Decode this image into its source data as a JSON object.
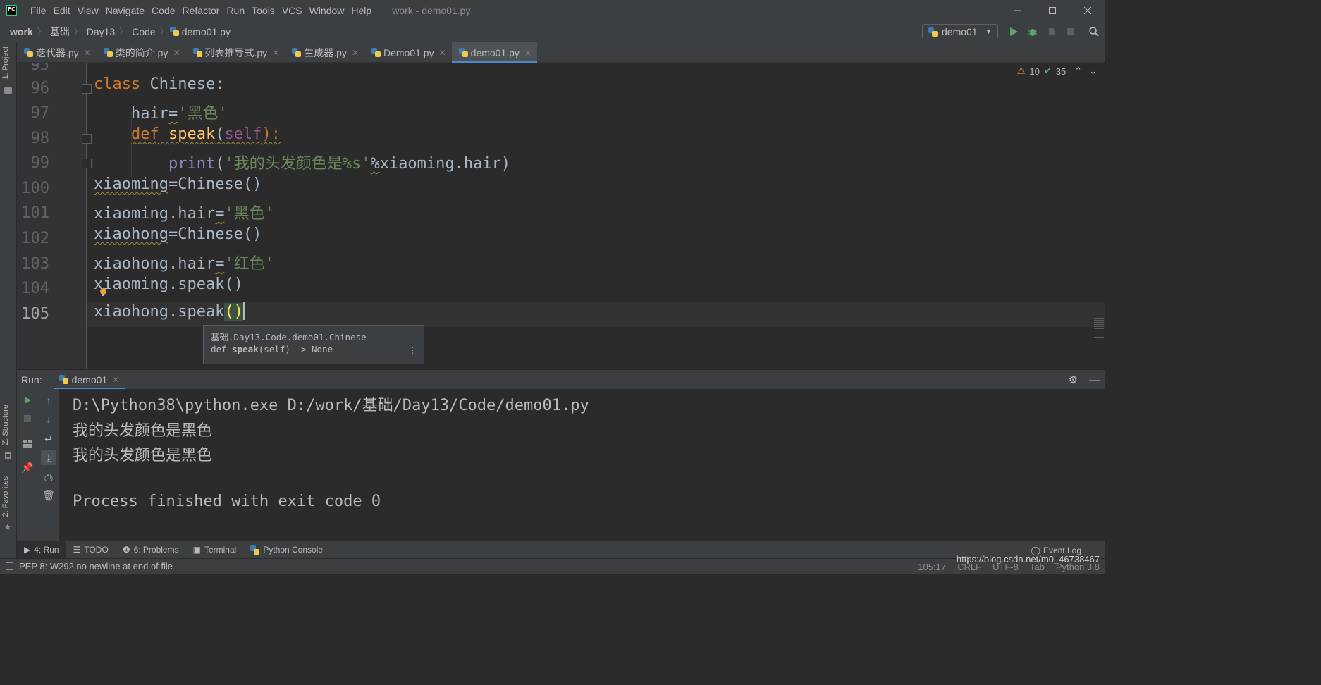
{
  "window": {
    "title": "work - demo01.py",
    "menu": [
      "File",
      "Edit",
      "View",
      "Navigate",
      "Code",
      "Refactor",
      "Run",
      "Tools",
      "VCS",
      "Window",
      "Help"
    ],
    "controls": [
      "minimize",
      "maximize",
      "close"
    ]
  },
  "breadcrumb": [
    "work",
    "基础",
    "Day13",
    "Code",
    "demo01.py"
  ],
  "run_config": {
    "label": "demo01"
  },
  "tabs": [
    {
      "label": "迭代器.py",
      "active": false
    },
    {
      "label": "类的简介.py",
      "active": false
    },
    {
      "label": "列表推导式.py",
      "active": false
    },
    {
      "label": "生成器.py",
      "active": false
    },
    {
      "label": "Demo01.py",
      "active": false
    },
    {
      "label": "demo01.py",
      "active": true
    }
  ],
  "inspections": {
    "warnings": "10",
    "weak_warnings": "35"
  },
  "editor": {
    "partial_line_number": "95",
    "line_numbers": [
      "96",
      "97",
      "98",
      "99",
      "100",
      "101",
      "102",
      "103",
      "104",
      "105"
    ],
    "current_line": "105",
    "lines": {
      "l96": {
        "kw": "class",
        "rest": " Chinese:"
      },
      "l97": {
        "name": "hair",
        "op": "=",
        "str": "'黑色'"
      },
      "l98": {
        "kw": "def",
        "fn": "speak",
        "open": "(",
        "self": "self",
        "close": "):"
      },
      "l99": {
        "bi": "print",
        "open": "(",
        "str": "'我的头发颜色是%s'",
        "op": "%",
        "rest": "xiaoming.hair)"
      },
      "l100": {
        "name": "xiaoming",
        "rest": "=Chinese()"
      },
      "l101": {
        "rest": "xiaoming.hair",
        "op": "=",
        "str": "'黑色'"
      },
      "l102": {
        "name": "xiaohong",
        "rest": "=Chinese()"
      },
      "l103": {
        "rest": "xiaohong.hair",
        "op": "=",
        "str": "'红色'"
      },
      "l104": {
        "rest": "xiaoming.speak()"
      },
      "l105": {
        "rest": "xiaohong.speak",
        "paren_open": "(",
        "paren_close": ")"
      }
    },
    "popup": {
      "line1": "基础.Day13.Code.demo01.Chinese",
      "line2_prefix": "def ",
      "line2_name": "speak",
      "line2_suffix": "(self) -> None",
      "more": "⋮"
    }
  },
  "run_panel": {
    "label": "Run:",
    "tab": "demo01",
    "output": [
      "D:\\Python38\\python.exe D:/work/基础/Day13/Code/demo01.py",
      "我的头发颜色是黑色",
      "我的头发颜色是黑色",
      "",
      "Process finished with exit code 0"
    ]
  },
  "left_strip": {
    "project": "1: Project",
    "structure": "Z: Structure",
    "favorites": "2: Favorites"
  },
  "bottom_tools": [
    {
      "label": "4: Run",
      "active": true
    },
    {
      "label": "TODO",
      "active": false
    },
    {
      "label": "6: Problems",
      "active": false
    },
    {
      "label": "Terminal",
      "active": false
    },
    {
      "label": "Python Console",
      "active": false
    }
  ],
  "event_log": "Event Log",
  "status": {
    "message": "PEP 8: W292 no newline at end of file",
    "position": "105:17",
    "line_sep": "CRLF",
    "encoding": "UTF-8",
    "indent": "Tab",
    "interpreter": "Python 3.8"
  },
  "watermark": "https://blog.csdn.net/m0_46738467"
}
